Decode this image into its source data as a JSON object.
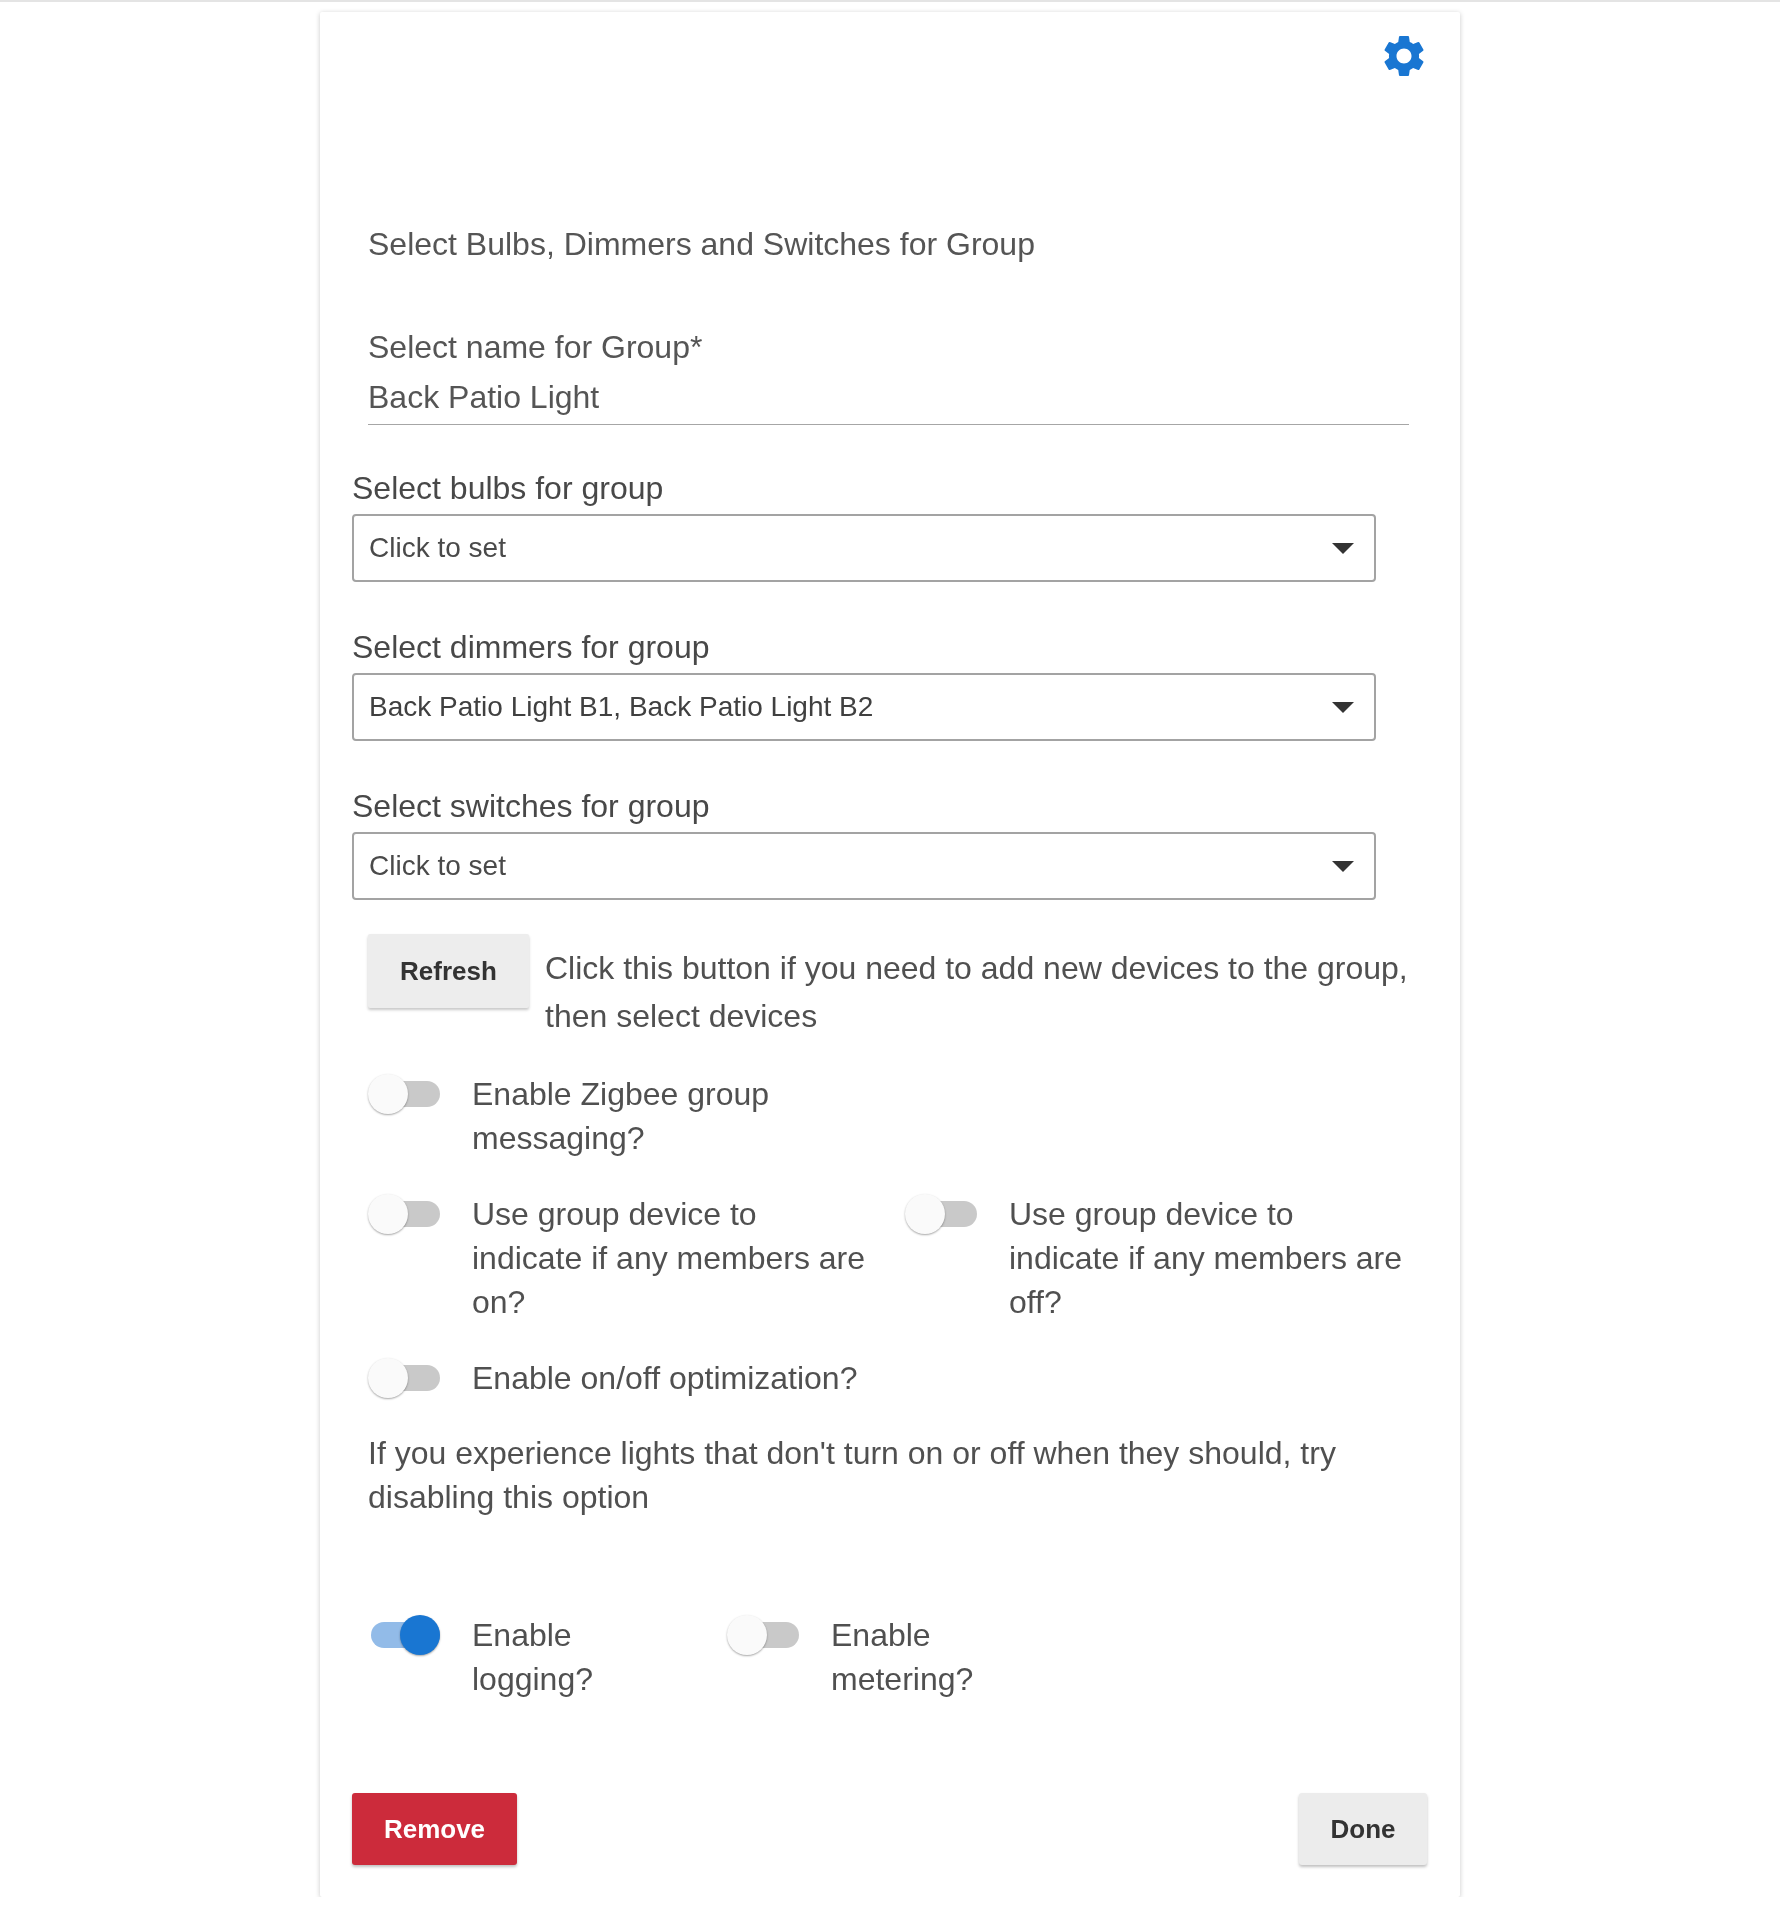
{
  "title": "Select Bulbs, Dimmers and Switches for Group",
  "name_field": {
    "label": "Select name for Group*",
    "value": "Back Patio Light"
  },
  "selects": [
    {
      "label": "Select bulbs for group",
      "placeholder": "Click to set"
    },
    {
      "label": "Select dimmers for group",
      "value": "Back Patio Light B1, Back Patio Light B2"
    },
    {
      "label": "Select switches for group",
      "placeholder": "Click to set"
    }
  ],
  "refresh": {
    "button": "Refresh",
    "text": "Click this button if you need to add new devices to the group, then select devices"
  },
  "sections": [
    {
      "kind": "toggle_row",
      "toggles": [
        {
          "label": "Enable Zigbee group messaging?",
          "on": false
        }
      ]
    },
    {
      "kind": "toggle_row",
      "toggles": [
        {
          "label": "Use group device to indicate if any members are on?",
          "on": false
        },
        {
          "label": "Use group device to indicate if any members are off?",
          "on": false
        }
      ]
    },
    {
      "kind": "toggle_row",
      "toggles": [
        {
          "label": "Enable on/off optimization?",
          "on": false
        }
      ]
    },
    {
      "kind": "note",
      "text": "If you experience lights that don't turn on or off when they should, try disabling this option"
    },
    {
      "kind": "compact_toggle_row",
      "toggles": [
        {
          "label": "Enable logging?",
          "on": true
        },
        {
          "label": "Enable metering?",
          "on": false
        }
      ]
    }
  ],
  "buttons": [
    {
      "label": "Remove",
      "kind": "danger"
    },
    {
      "label": "Done",
      "kind": "default"
    }
  ]
}
